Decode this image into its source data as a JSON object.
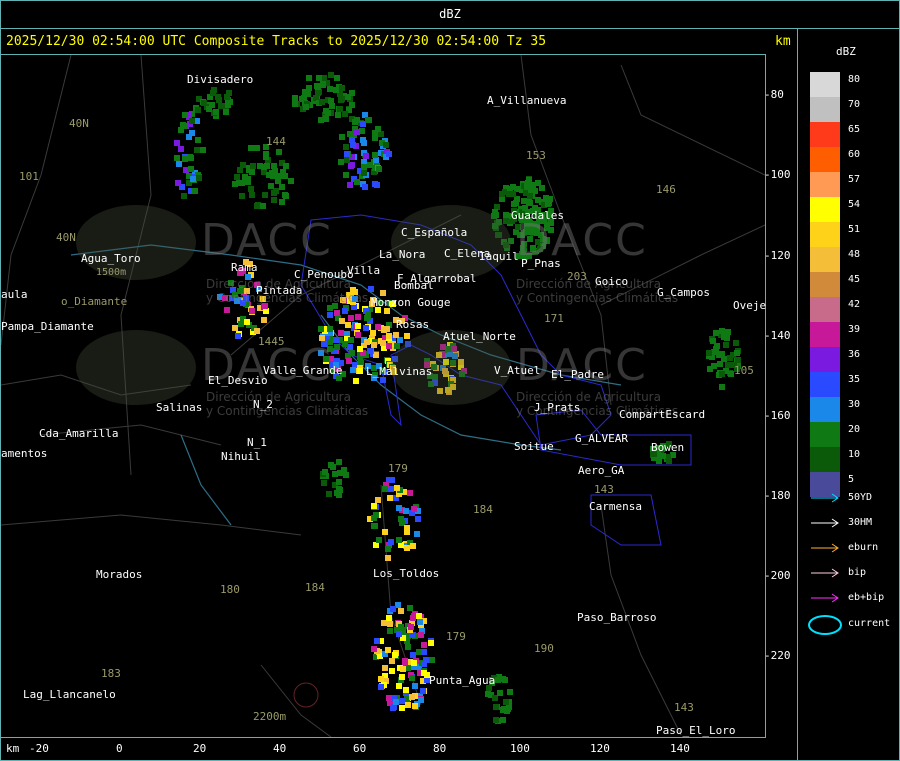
{
  "legend": {
    "unit": "dBZ",
    "levels": [
      {
        "label": "80",
        "color": "#d8d8d8"
      },
      {
        "label": "70",
        "color": "#c0c0c0"
      },
      {
        "label": "65",
        "color": "#ff3a1a"
      },
      {
        "label": "60",
        "color": "#ff5e00"
      },
      {
        "label": "57",
        "color": "#ff9a55"
      },
      {
        "label": "54",
        "color": "#ffff00"
      },
      {
        "label": "51",
        "color": "#ffd21a"
      },
      {
        "label": "48",
        "color": "#f5be38"
      },
      {
        "label": "45",
        "color": "#d18a3a"
      },
      {
        "label": "42",
        "color": "#c86a8a"
      },
      {
        "label": "39",
        "color": "#c8189a"
      },
      {
        "label": "36",
        "color": "#7a1ae0"
      },
      {
        "label": "35",
        "color": "#2a4aff"
      },
      {
        "label": "30",
        "color": "#1a88e8"
      },
      {
        "label": "20",
        "color": "#0f7a14"
      },
      {
        "label": "10",
        "color": "#0a5a0a"
      },
      {
        "label": "5",
        "color": "#4a4a9a"
      }
    ],
    "tracks": [
      {
        "label": "50YD",
        "color": "#00e0ff"
      },
      {
        "label": "30HM",
        "color": "#ffffff"
      },
      {
        "label": "eburn",
        "color": "#ffb030"
      },
      {
        "label": "bip",
        "color": "#ffd0e0"
      },
      {
        "label": "eb+bip",
        "color": "#ff30ff"
      }
    ],
    "current_label": "current"
  },
  "header": {
    "text": "2025/12/30 02:54:00 UTC Composite Tracks to 2025/12/30 02:54:00 Tz 35",
    "km": "km"
  },
  "axes": {
    "y_ticks": [
      "-80",
      "-100",
      "-120",
      "-140",
      "-160",
      "-180",
      "-200",
      "-220"
    ],
    "x_ticks": [
      "-20",
      "0",
      "20",
      "40",
      "60",
      "80",
      "100",
      "120",
      "140"
    ],
    "x_unit": "km"
  },
  "places": [
    {
      "name": "Divisadero"
    },
    {
      "name": "A_Villanueva"
    },
    {
      "name": "40N"
    },
    {
      "name": "101"
    },
    {
      "name": "40N"
    },
    {
      "name": "Agua_Toro"
    },
    {
      "name": "1500m"
    },
    {
      "name": "aula"
    },
    {
      "name": "o_Diamante"
    },
    {
      "name": "Pampa_Diamante"
    },
    {
      "name": "Rama"
    },
    {
      "name": "Pintada"
    },
    {
      "name": "El_Desvio"
    },
    {
      "name": "Valle_Grande"
    },
    {
      "name": "Salinas"
    },
    {
      "name": "Cda_Amarilla"
    },
    {
      "name": "amentos"
    },
    {
      "name": "N_1"
    },
    {
      "name": "Nihuil"
    },
    {
      "name": "N_2"
    },
    {
      "name": "Morados"
    },
    {
      "name": "Lag_Llancanelo"
    },
    {
      "name": "2200m"
    },
    {
      "name": "Los_Toldos"
    },
    {
      "name": "Punta_Agua"
    },
    {
      "name": "Paso_Barroso"
    },
    {
      "name": "Paso_El_Loro"
    },
    {
      "name": "Guadales"
    },
    {
      "name": "C_Española"
    },
    {
      "name": "C_Elena"
    },
    {
      "name": "La_Nora"
    },
    {
      "name": "Villa"
    },
    {
      "name": "F_Algarrobal"
    },
    {
      "name": "Bombal"
    },
    {
      "name": "Monzon Gouge"
    },
    {
      "name": "Rosas"
    },
    {
      "name": "Atuel_Norte"
    },
    {
      "name": "L_Malvinas"
    },
    {
      "name": "V_Atuel"
    },
    {
      "name": "El_Padre"
    },
    {
      "name": "J_Prats"
    },
    {
      "name": "CompartEscard"
    },
    {
      "name": "G_ALVEAR"
    },
    {
      "name": "Bowen"
    },
    {
      "name": "Soitue"
    },
    {
      "name": "Aero_GA"
    },
    {
      "name": "Carmensa"
    },
    {
      "name": "Goico"
    },
    {
      "name": "G_Campos"
    },
    {
      "name": "Oveje"
    },
    {
      "name": "Iaquil"
    },
    {
      "name": "P_Pnas"
    },
    {
      "name": "C_Penoubo"
    },
    {
      "name": "153"
    },
    {
      "name": "146"
    },
    {
      "name": "171"
    },
    {
      "name": "143"
    },
    {
      "name": "179"
    },
    {
      "name": "184"
    },
    {
      "name": "180"
    },
    {
      "name": "183"
    },
    {
      "name": "190"
    },
    {
      "name": "184"
    },
    {
      "name": "179"
    },
    {
      "name": "105"
    },
    {
      "name": "144"
    },
    {
      "name": "1445"
    },
    {
      "name": "203"
    },
    {
      "name": "143"
    }
  ],
  "watermark": {
    "brand": "DACC",
    "line1": "Dirección de Agricultura",
    "line2": "y Contingencias Climáticas"
  }
}
